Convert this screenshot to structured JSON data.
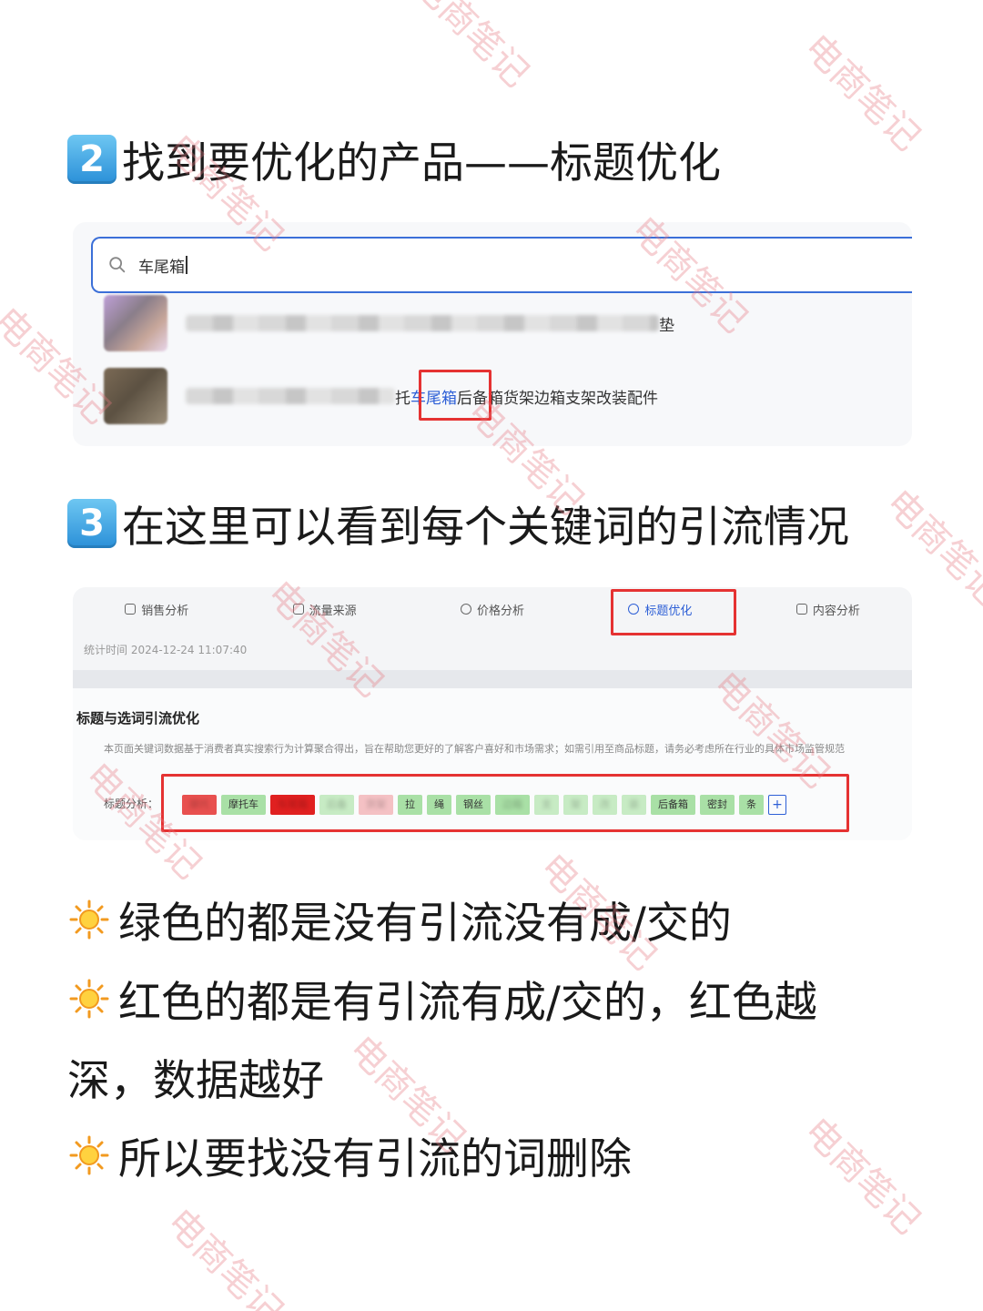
{
  "step2": {
    "num": "2",
    "text": "找到要优化的产品——标题优化"
  },
  "search": {
    "query": "车尾箱",
    "result2": {
      "prefix": "托",
      "highlight": "车尾箱",
      "suffix": "后备箱货架边箱支架改装配件"
    },
    "result1": {
      "suffix": "垫"
    }
  },
  "step3": {
    "num": "3",
    "text": "在这里可以看到每个关键词的引流情况"
  },
  "analysis": {
    "tabs": [
      "销售分析",
      "流量来源",
      "价格分析",
      "标题优化",
      "内容分析"
    ],
    "active_tab": "标题优化",
    "stat_time": "统计时间 2024-12-24 11:07:40",
    "section_title": "标题与选词引流优化",
    "description": "本页面关键词数据基于消费者真实搜索行为计算聚合得出，旨在帮助您更好的了解客户喜好和市场需求；如需引用至商品标题，请务必考虑所在行业的具体市场监管规范",
    "keyword_label": "标题分析：",
    "keywords": [
      {
        "text": "摩托",
        "color": "red",
        "blur": true
      },
      {
        "text": "摩托车",
        "color": "green",
        "blur": false
      },
      {
        "text": "车尾箱",
        "color": "deepred",
        "blur": true
      },
      {
        "text": "后备",
        "color": "lightgreen",
        "blur": true
      },
      {
        "text": "货架",
        "color": "pink",
        "blur": true
      },
      {
        "text": "拉",
        "color": "green",
        "blur": false
      },
      {
        "text": "绳",
        "color": "green",
        "blur": false
      },
      {
        "text": "钢丝",
        "color": "green",
        "blur": false
      },
      {
        "text": "边箱",
        "color": "green",
        "blur": true
      },
      {
        "text": "支",
        "color": "lightgreen",
        "blur": true
      },
      {
        "text": "架",
        "color": "lightgreen",
        "blur": true
      },
      {
        "text": "改",
        "color": "lightgreen",
        "blur": true
      },
      {
        "text": "装",
        "color": "lightgreen",
        "blur": true
      },
      {
        "text": "后备箱",
        "color": "green",
        "blur": false
      },
      {
        "text": "密封",
        "color": "green",
        "blur": false
      },
      {
        "text": "条",
        "color": "green",
        "blur": false
      }
    ],
    "add_label": "+"
  },
  "bullets": [
    "绿色的都是没有引流没有成/交的",
    "红色的都是有引流有成/交的，红色越",
    "深，数据越好",
    "所以要找没有引流的词删除"
  ],
  "watermark": "电商笔记",
  "colors": {
    "highlight_blue": "#2d5fd6",
    "annotation_red": "#e53232",
    "keycap_blue": "#2a8fd8"
  }
}
